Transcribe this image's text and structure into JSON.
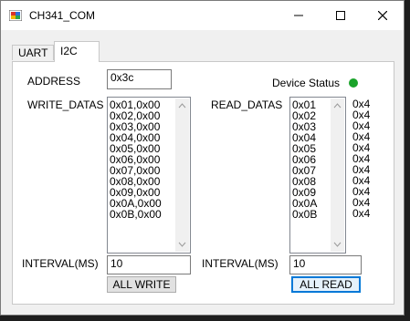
{
  "window": {
    "title": "CH341_COM",
    "minimize": "—",
    "maximize": "☐",
    "close": "✕"
  },
  "tabs": [
    {
      "label": "UART"
    },
    {
      "label": "I2C"
    }
  ],
  "address": {
    "label": "ADDRESS",
    "value": "0x3c"
  },
  "device_status": {
    "label": "Device Status",
    "color": "#1aa32a"
  },
  "write": {
    "label": "WRITE_DATAS",
    "items": [
      "0x01,0x00",
      "0x02,0x00",
      "0x03,0x00",
      "0x04,0x00",
      "0x05,0x00",
      "0x06,0x00",
      "0x07,0x00",
      "0x08,0x00",
      "0x09,0x00",
      "0x0A,0x00",
      "0x0B,0x00"
    ],
    "interval_label": "INTERVAL(MS)",
    "interval_value": "10",
    "button": "ALL WRITE"
  },
  "read": {
    "label": "READ_DATAS",
    "items": [
      "0x01",
      "0x02",
      "0x03",
      "0x04",
      "0x05",
      "0x06",
      "0x07",
      "0x08",
      "0x09",
      "0x0A",
      "0x0B"
    ],
    "values": [
      "0x4",
      "0x4",
      "0x4",
      "0x4",
      "0x4",
      "0x4",
      "0x4",
      "0x4",
      "0x4",
      "0x4",
      "0x4"
    ],
    "interval_label": "INTERVAL(MS)",
    "interval_value": "10",
    "button": "ALL READ"
  }
}
